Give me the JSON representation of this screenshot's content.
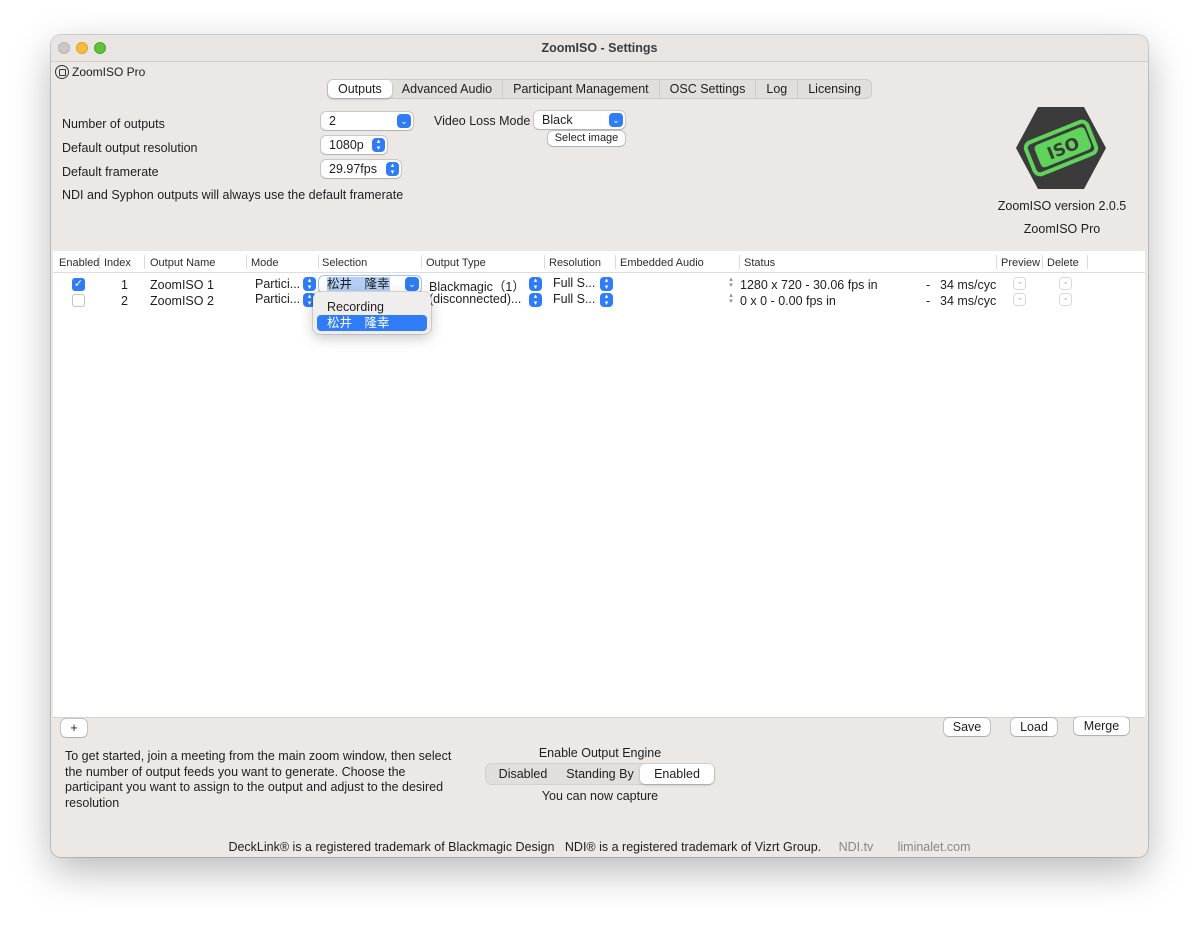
{
  "window": {
    "title": "ZoomISO - Settings",
    "app_menu_label": "ZoomISO Pro"
  },
  "tabs": [
    {
      "label": "Outputs",
      "active": true
    },
    {
      "label": "Advanced Audio",
      "active": false
    },
    {
      "label": "Participant Management",
      "active": false
    },
    {
      "label": "OSC Settings",
      "active": false
    },
    {
      "label": "Log",
      "active": false
    },
    {
      "label": "Licensing",
      "active": false
    }
  ],
  "settings": {
    "num_outputs_label": "Number of outputs",
    "num_outputs_value": "2",
    "resolution_label": "Default output resolution",
    "resolution_value": "1080p",
    "framerate_label": "Default framerate",
    "framerate_value": "29.97fps",
    "ndi_note": "NDI and Syphon outputs will always use the default framerate",
    "video_loss_label": "Video Loss Mode",
    "video_loss_value": "Black",
    "select_image_label": "Select image"
  },
  "logo": {
    "text": "ISO",
    "version_text": "ZoomISO version 2.0.5",
    "edition_text": "ZoomISO Pro",
    "accent_color": "#5fd35a",
    "dark_color": "#3b3b3b"
  },
  "table": {
    "headers": [
      "Enabled",
      "Index",
      "Output Name",
      "Mode",
      "Selection",
      "Output Type",
      "Resolution",
      "Embedded Audio",
      "Status",
      "Preview",
      "Delete"
    ],
    "rows": [
      {
        "enabled": true,
        "index": "1",
        "name": "ZoomISO 1",
        "mode": "Partici...",
        "selection": "松井　隆幸",
        "output_type": "Blackmagic（1）",
        "resolution": "Full S...",
        "status": "1280 x 720 - 30.06 fps in",
        "status_dash": "-",
        "cycle": "34 ms/cyc"
      },
      {
        "enabled": false,
        "index": "2",
        "name": "ZoomISO 2",
        "mode": "Partici...",
        "selection": "",
        "output_type": "(disconnected)...",
        "resolution": "Full S...",
        "status": "0 x 0 - 0.00 fps in",
        "status_dash": "-",
        "cycle": "34 ms/cyc"
      }
    ]
  },
  "dropdown": {
    "items": [
      {
        "label": "Recording",
        "selected": false
      },
      {
        "label": "松井　隆幸",
        "selected": true
      }
    ]
  },
  "bottom_bar": {
    "add_label": "+",
    "save_label": "Save",
    "load_label": "Load",
    "merge_label": "Merge"
  },
  "help_text": "To get started, join a meeting from the main zoom window, then select the number of output feeds you want to generate. Choose the participant you want to assign to the output and adjust to the desired resolution",
  "engine": {
    "title": "Enable Output Engine",
    "options": [
      "Disabled",
      "Standing By",
      "Enabled"
    ],
    "selected": "Enabled",
    "status": "You can now capture"
  },
  "footer": {
    "decklink": "DeckLink® is a registered trademark of Blackmagic Design",
    "ndi": "NDI® is a registered trademark of Vizrt Group.",
    "ndi_link": "NDI.tv",
    "site_link": "liminalet.com"
  },
  "colors": {
    "accent": "#2f7cf6",
    "window_bg": "#ece8e6"
  }
}
